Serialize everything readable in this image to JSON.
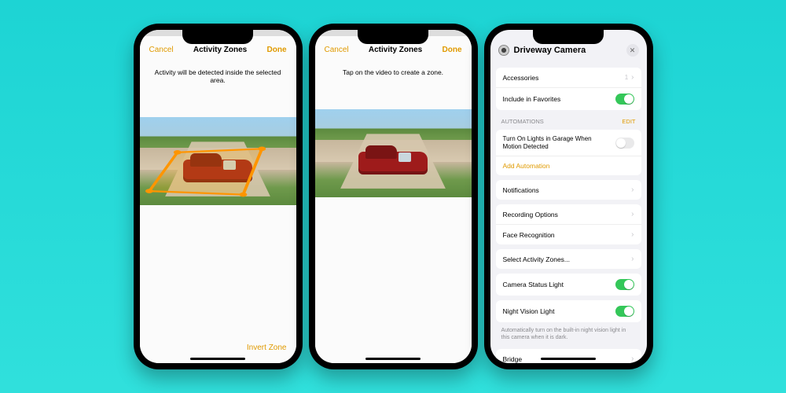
{
  "screen1": {
    "cancel": "Cancel",
    "title": "Activity Zones",
    "done": "Done",
    "help": "Activity will be detected inside the selected area.",
    "invert": "Invert Zone"
  },
  "screen2": {
    "cancel": "Cancel",
    "title": "Activity Zones",
    "done": "Done",
    "help": "Tap on the video to create a zone."
  },
  "screen3": {
    "device_name": "Driveway Camera",
    "accessories_label": "Accessories",
    "accessories_count": "1",
    "favorites_label": "Include in Favorites",
    "favorites_on": true,
    "automations_header": "AUTOMATIONS",
    "automations_edit": "EDIT",
    "automation1_title": "Turn On Lights in Garage When Motion Detected",
    "automation1_on": false,
    "add_automation": "Add Automation",
    "notifications": "Notifications",
    "recording_options": "Recording Options",
    "face_recognition": "Face Recognition",
    "select_zones": "Select Activity Zones...",
    "status_light_label": "Camera Status Light",
    "status_light_on": true,
    "night_vision_label": "Night Vision Light",
    "night_vision_on": true,
    "night_vision_help": "Automatically turn on the built-in night vision light in this camera when it is dark.",
    "bridge": "Bridge"
  }
}
